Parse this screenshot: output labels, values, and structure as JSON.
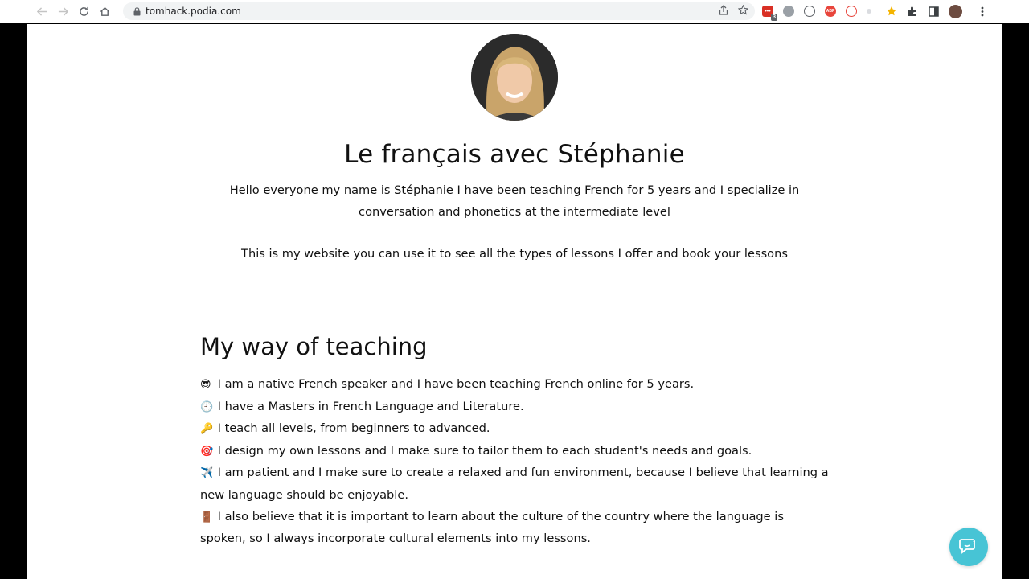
{
  "browser": {
    "url": "tomhack.podia.com",
    "extension_badge": "3",
    "abp_label": "ABP"
  },
  "page": {
    "title": "Le français avec Stéphanie",
    "intro_line1": "Hello everyone my name is Stéphanie I have been teaching French for 5 years and I specialize in conversation and phonetics at the intermediate level",
    "intro_line2": "This is my website you can use it to see all the types of lessons I offer and book your lessons",
    "section_heading": "My way of teaching",
    "items": [
      {
        "icon": "😎",
        "text": "I am a native French speaker and I have been teaching French online for 5 years."
      },
      {
        "icon": "🕘",
        "text": "I have a Masters in French Language and Literature."
      },
      {
        "icon": "🔑",
        "text": "I teach all levels, from beginners to advanced."
      },
      {
        "icon": "🎯",
        "text": "I design my own lessons and I make sure to tailor them to each student's needs and goals."
      },
      {
        "icon": "✈️",
        "text": "I am patient and I make sure to create a relaxed and fun environment, because I believe that learning a new language should be enjoyable."
      },
      {
        "icon": "🚪",
        "text": "I also believe that it is important to learn about the culture of the country where the language is spoken, so I always incorporate cultural elements into my lessons."
      }
    ]
  },
  "colors": {
    "chat_button": "#47c4d5",
    "text": "#111111"
  }
}
